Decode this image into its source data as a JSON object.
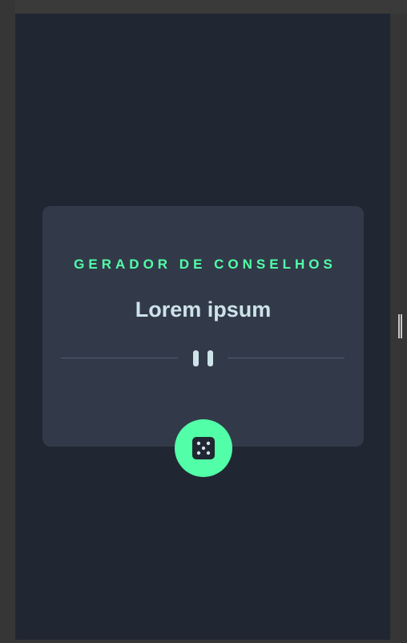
{
  "advice_card": {
    "title": "GERADOR DE CONSELHOS",
    "quote": "Lorem ipsum"
  },
  "icons": {
    "divider": "pause-icon",
    "generate": "dice-icon"
  },
  "colors": {
    "background": "#202632",
    "card": "#323a49",
    "accent": "#52ffa8",
    "text": "#cee3e9",
    "divider": "#4f5d74"
  }
}
